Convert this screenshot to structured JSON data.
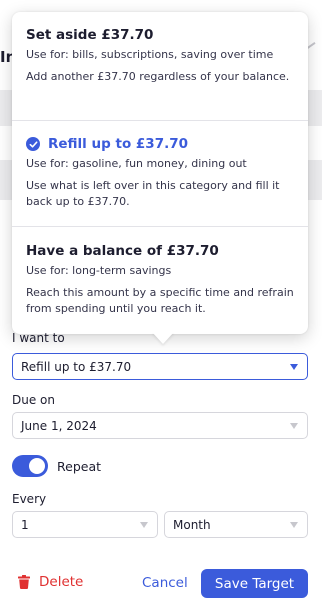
{
  "background": {
    "title_fragment": "In"
  },
  "popover": {
    "options": [
      {
        "title": "Set aside £37.70",
        "use_for": "Use for: bills, subscriptions, saving over time",
        "description": "Add another £37.70 regardless of your balance.",
        "selected": false
      },
      {
        "title": "Refill up to £37.70",
        "use_for": "Use for: gasoline, fun money, dining out",
        "description": "Use what is left over in this category and fill it back up to £37.70.",
        "selected": true
      },
      {
        "title": "Have a balance of £37.70",
        "use_for": "Use for: long-term savings",
        "description": "Reach this amount by a specific time and refrain from spending until you reach it.",
        "selected": false
      }
    ]
  },
  "form": {
    "want_label": "I want to",
    "want_value": "Refill up to £37.70",
    "due_label": "Due on",
    "due_value": "June 1, 2024",
    "repeat_label": "Repeat",
    "repeat_on": true,
    "every_label": "Every",
    "every_count": "1",
    "every_unit": "Month"
  },
  "footer": {
    "delete_label": "Delete",
    "cancel_label": "Cancel",
    "save_label": "Save Target"
  },
  "colors": {
    "accent": "#3b5bdb",
    "danger": "#e03131"
  }
}
